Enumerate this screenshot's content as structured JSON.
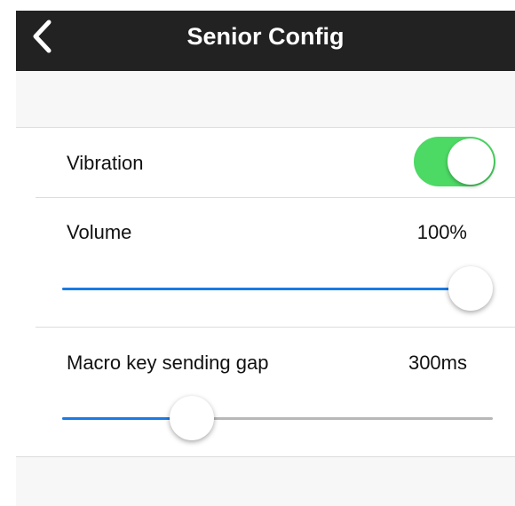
{
  "header": {
    "back_icon": "chevron-left-icon",
    "title": "Senior Config"
  },
  "settings": {
    "vibration": {
      "label": "Vibration",
      "enabled": true,
      "color": "#4cd964"
    },
    "volume": {
      "label": "Volume",
      "value_text": "100%",
      "level": 1.0
    },
    "macro_gap": {
      "label": "Macro key sending gap",
      "value_text": "300ms",
      "level": 0.3
    }
  },
  "colors": {
    "nav_background": "#222222",
    "slider_accent": "#1a7ae6",
    "page_background": "#f7f7f7"
  }
}
